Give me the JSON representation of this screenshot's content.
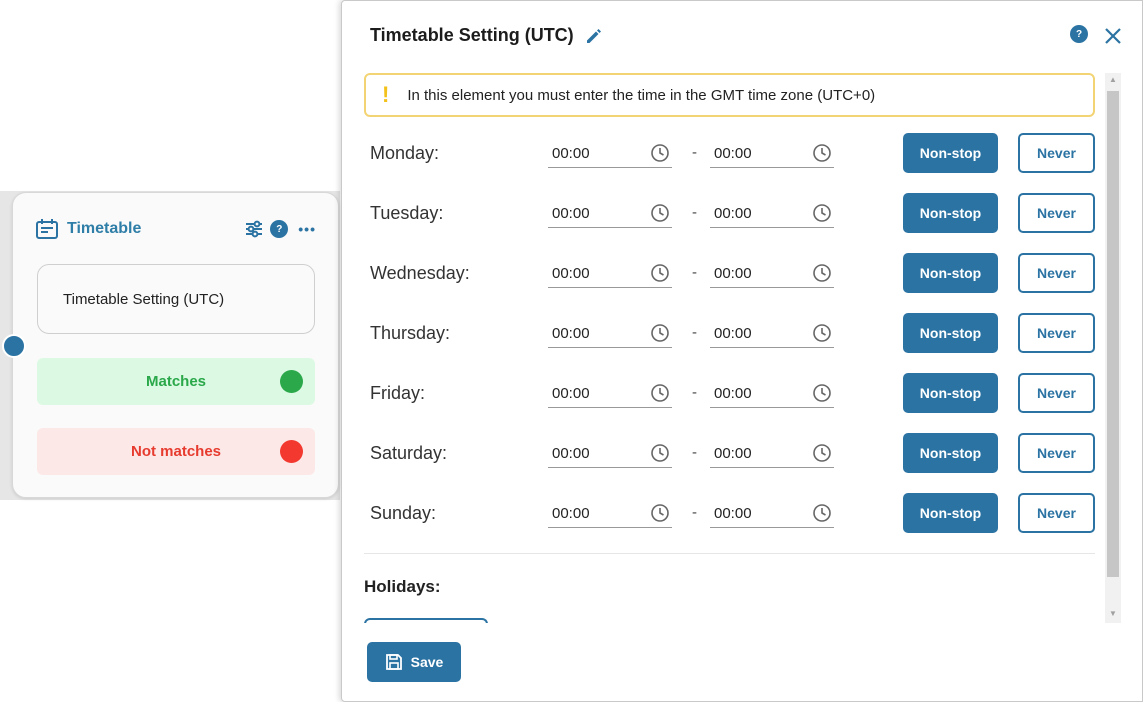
{
  "node": {
    "title": "Timetable",
    "help": "?",
    "more": "•••",
    "setting_name": "Timetable Setting (UTC)",
    "outputs": {
      "matches": "Matches",
      "not_matches": "Not matches"
    }
  },
  "dialog": {
    "title": "Timetable Setting (UTC)",
    "help": "?",
    "warning": "In this element you must enter the time in the GMT time zone (UTC+0)",
    "warning_mark": "!",
    "dash": "-",
    "nonstop_label": "Non-stop",
    "never_label": "Never",
    "days": [
      {
        "label": "Monday:",
        "from": "00:00",
        "to": "00:00"
      },
      {
        "label": "Tuesday:",
        "from": "00:00",
        "to": "00:00"
      },
      {
        "label": "Wednesday:",
        "from": "00:00",
        "to": "00:00"
      },
      {
        "label": "Thursday:",
        "from": "00:00",
        "to": "00:00"
      },
      {
        "label": "Friday:",
        "from": "00:00",
        "to": "00:00"
      },
      {
        "label": "Saturday:",
        "from": "00:00",
        "to": "00:00"
      },
      {
        "label": "Sunday:",
        "from": "00:00",
        "to": "00:00"
      }
    ],
    "holidays_label": "Holidays:",
    "save_label": "Save"
  },
  "colors": {
    "accent": "#2b73a3",
    "match_green": "#2aa84a",
    "nomatch_red": "#f2382f",
    "warning_border": "#f3d474"
  }
}
